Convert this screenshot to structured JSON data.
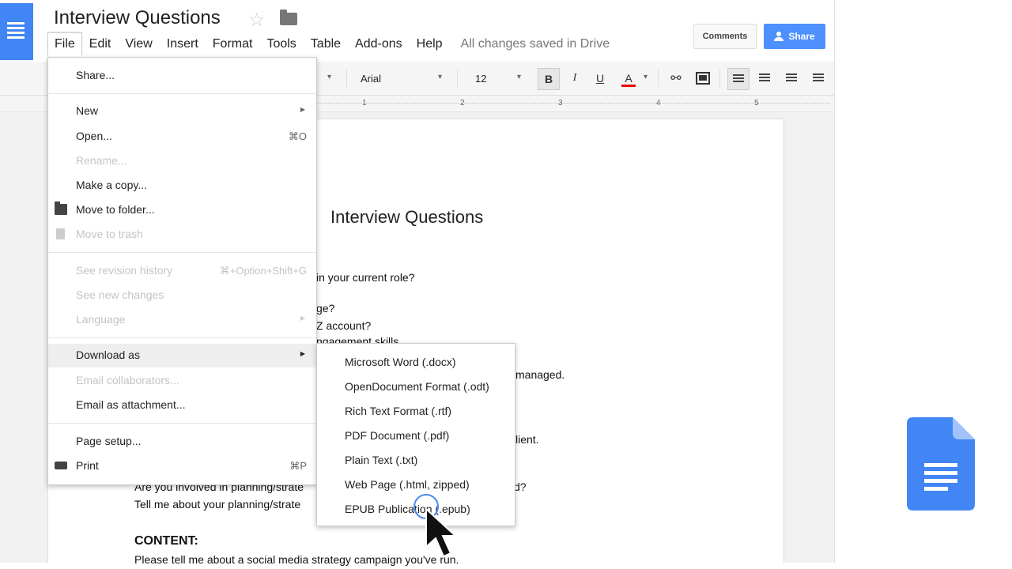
{
  "app": {
    "doc_title": "Interview Questions",
    "menus": [
      "File",
      "Edit",
      "View",
      "Insert",
      "Format",
      "Tools",
      "Table",
      "Add-ons",
      "Help"
    ],
    "saved_status": "All changes saved in Drive",
    "comments_label": "Comments",
    "share_label": "Share"
  },
  "toolbar": {
    "font": "Arial",
    "size": "12",
    "bold": "B",
    "italic": "I",
    "underline": "U",
    "text_color": "A",
    "ruler_numbers": [
      "1",
      "2",
      "3",
      "4",
      "5"
    ]
  },
  "document": {
    "title": "Interview Questions",
    "lines": [
      "in your current role?",
      "ge?",
      "Z account?",
      "ngagement skills",
      "managed.",
      "lient.",
      "Are you involved in planning/strate",
      "d?",
      "Tell me about your planning/strate",
      "Please tell me about a social media strategy campaign you've run."
    ],
    "content_heading": "CONTENT:"
  },
  "file_menu": {
    "share": "Share...",
    "new": "New",
    "open": "Open...",
    "open_shortcut": "⌘O",
    "rename": "Rename...",
    "make_copy": "Make a copy...",
    "move_to_folder": "Move to folder...",
    "move_to_trash": "Move to trash",
    "revision_history": "See revision history",
    "revision_shortcut": "⌘+Option+Shift+G",
    "new_changes": "See new changes",
    "language": "Language",
    "download_as": "Download as",
    "email_collaborators": "Email collaborators...",
    "email_attachment": "Email as attachment...",
    "page_setup": "Page setup...",
    "print": "Print",
    "print_shortcut": "⌘P"
  },
  "download_submenu": [
    "Microsoft Word (.docx)",
    "OpenDocument Format (.odt)",
    "Rich Text Format (.rtf)",
    "PDF Document (.pdf)",
    "Plain Text (.txt)",
    "Web Page (.html, zipped)",
    "EPUB Publication (.epub)"
  ],
  "colors": {
    "brand_blue": "#4285f4",
    "share_button": "#4d90fe",
    "text_color_red": "#e00000"
  },
  "icons": [
    "menu-icon",
    "star-icon",
    "folder-icon",
    "person-icon",
    "link-icon",
    "image-icon",
    "align-left-icon",
    "align-center-icon",
    "align-right-icon",
    "justify-icon",
    "trash-icon",
    "print-icon",
    "cursor-icon",
    "google-docs-logo"
  ]
}
